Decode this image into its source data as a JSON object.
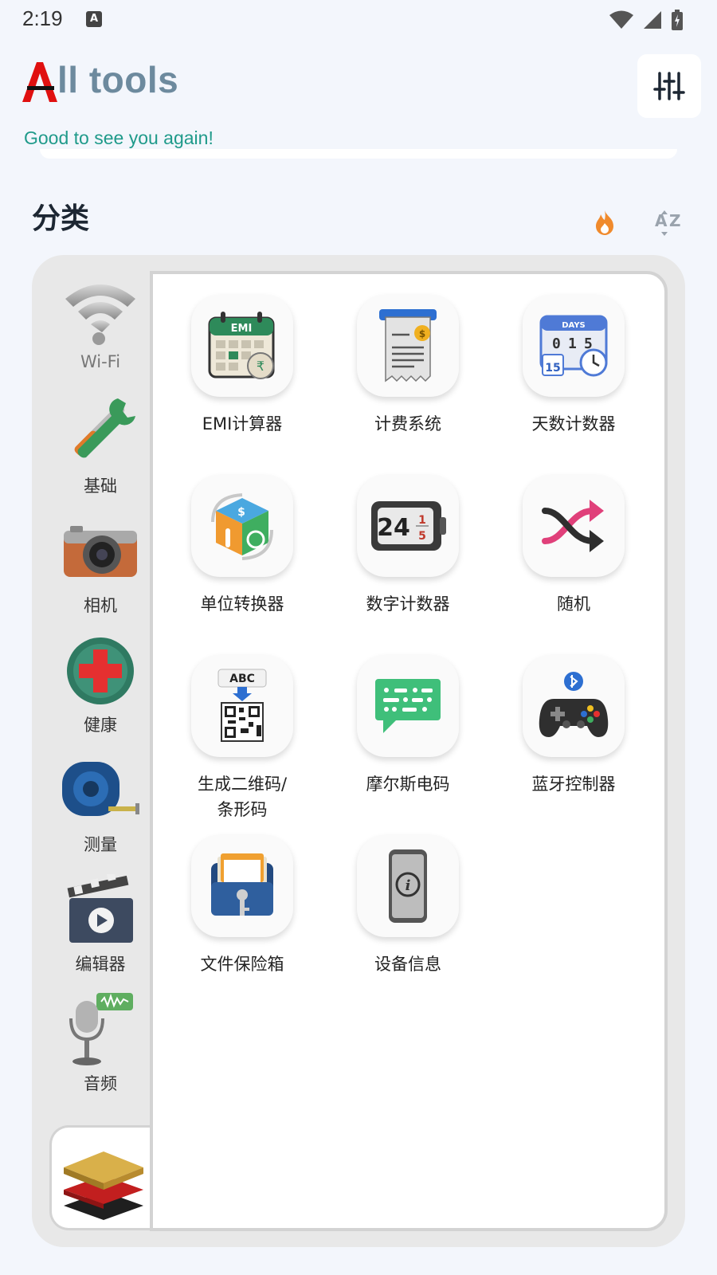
{
  "status_bar": {
    "time": "2:19",
    "notification_icon": "A"
  },
  "header": {
    "title": "ll tools",
    "greeting": "Good to see you again!"
  },
  "categories_section": {
    "title": "分类"
  },
  "sidebar": {
    "items": [
      {
        "label": "Wi-Fi",
        "icon": "wifi-icon"
      },
      {
        "label": "基础",
        "icon": "wrench-screwdriver-icon"
      },
      {
        "label": "相机",
        "icon": "camera-icon"
      },
      {
        "label": "健康",
        "icon": "health-cross-icon"
      },
      {
        "label": "测量",
        "icon": "tape-measure-icon"
      },
      {
        "label": "编辑器",
        "icon": "video-editor-icon"
      },
      {
        "label": "音频",
        "icon": "microphone-icon"
      },
      {
        "label": "",
        "icon": "layers-icon"
      }
    ]
  },
  "tools": [
    {
      "label": "EMI计算器",
      "icon": "emi-calendar-icon"
    },
    {
      "label": "计费系统",
      "icon": "receipt-icon"
    },
    {
      "label": "天数计数器",
      "icon": "days-counter-icon"
    },
    {
      "label": "单位转换器",
      "icon": "unit-cube-icon"
    },
    {
      "label": "数字计数器",
      "icon": "number-counter-icon"
    },
    {
      "label": "随机",
      "icon": "shuffle-icon"
    },
    {
      "label": "生成二维码/\n条形码",
      "icon": "qr-code-icon"
    },
    {
      "label": "摩尔斯电码",
      "icon": "morse-chat-icon"
    },
    {
      "label": "蓝牙控制器",
      "icon": "gamepad-icon"
    },
    {
      "label": "文件保险箱",
      "icon": "file-vault-icon"
    },
    {
      "label": "设备信息",
      "icon": "device-info-icon"
    }
  ],
  "colors": {
    "accent_teal": "#1f9a8a",
    "title_blue_gray": "#6d8a9e",
    "fire_orange": "#f08a2c"
  }
}
